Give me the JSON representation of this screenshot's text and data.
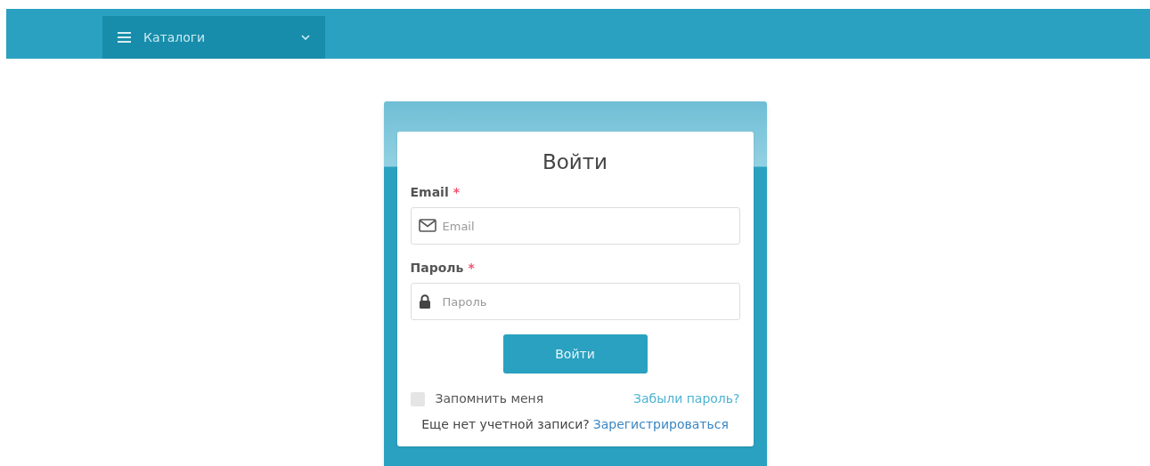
{
  "navbar": {
    "menu": {
      "label": "Каталоги",
      "expanded": false
    }
  },
  "login": {
    "title": "Войти",
    "fields": [
      {
        "kind": "email",
        "label": "Email",
        "required_mark": "*",
        "placeholder": "Email"
      },
      {
        "kind": "password",
        "label": "Пароль",
        "required_mark": "*",
        "placeholder": "Пароль"
      }
    ],
    "submit": "Войти",
    "remember": {
      "label": "Запомнить меня",
      "checked": false
    },
    "forgot": "Забыли пароль?",
    "signup_prompt": "Еще нет учетной записи?",
    "signup_link": "Зарегистрироваться"
  }
}
